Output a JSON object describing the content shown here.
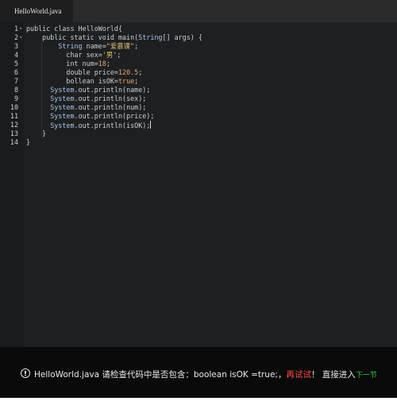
{
  "tab": {
    "label": "HelloWorld.java"
  },
  "editor": {
    "lines": [
      {
        "n": "1",
        "fold": "▾",
        "segments": [
          {
            "t": "public class HelloWorld{",
            "c": "pl"
          }
        ]
      },
      {
        "n": "2",
        "fold": "▾",
        "segments": [
          {
            "t": "    public static void main(",
            "c": "pl"
          },
          {
            "t": "String",
            "c": "cls"
          },
          {
            "t": "[] args) {",
            "c": "pl"
          }
        ]
      },
      {
        "n": "3",
        "fold": "",
        "segments": [
          {
            "t": "        ",
            "c": "pl"
          },
          {
            "t": "String",
            "c": "cls"
          },
          {
            "t": " name=",
            "c": "pl"
          },
          {
            "t": "\"爱慕课\"",
            "c": "str"
          },
          {
            "t": ";",
            "c": "pl"
          }
        ]
      },
      {
        "n": "4",
        "fold": "",
        "segments": [
          {
            "t": "          char sex=",
            "c": "pl"
          },
          {
            "t": "'男'",
            "c": "str"
          },
          {
            "t": ";",
            "c": "pl"
          }
        ]
      },
      {
        "n": "5",
        "fold": "",
        "segments": [
          {
            "t": "          int num=",
            "c": "pl"
          },
          {
            "t": "18",
            "c": "num"
          },
          {
            "t": ";",
            "c": "pl"
          }
        ]
      },
      {
        "n": "6",
        "fold": "",
        "segments": [
          {
            "t": "          double price=",
            "c": "pl"
          },
          {
            "t": "120.5",
            "c": "num"
          },
          {
            "t": ";",
            "c": "pl"
          }
        ]
      },
      {
        "n": "7",
        "fold": "",
        "segments": [
          {
            "t": "          bollean isOK=",
            "c": "pl"
          },
          {
            "t": "true",
            "c": "num"
          },
          {
            "t": ";",
            "c": "pl"
          }
        ]
      },
      {
        "n": "8",
        "fold": "",
        "segments": [
          {
            "t": "      ",
            "c": "pl"
          },
          {
            "t": "System",
            "c": "cls"
          },
          {
            "t": ".out.println(name);",
            "c": "pl"
          }
        ]
      },
      {
        "n": "9",
        "fold": "",
        "segments": [
          {
            "t": "      ",
            "c": "pl"
          },
          {
            "t": "System",
            "c": "cls"
          },
          {
            "t": ".out.println(sex);",
            "c": "pl"
          }
        ]
      },
      {
        "n": "10",
        "fold": "",
        "segments": [
          {
            "t": "      ",
            "c": "pl"
          },
          {
            "t": "System",
            "c": "cls"
          },
          {
            "t": ".out.println(num);",
            "c": "pl"
          }
        ]
      },
      {
        "n": "11",
        "fold": "",
        "segments": [
          {
            "t": "      ",
            "c": "pl"
          },
          {
            "t": "System",
            "c": "cls"
          },
          {
            "t": ".out.println(price);",
            "c": "pl"
          }
        ]
      },
      {
        "n": "12",
        "fold": "",
        "segments": [
          {
            "t": "      ",
            "c": "pl"
          },
          {
            "t": "System",
            "c": "cls"
          },
          {
            "t": ".out.println(isOK);",
            "c": "pl"
          }
        ],
        "caret": true
      },
      {
        "n": "13",
        "fold": "",
        "segments": [
          {
            "t": "    }",
            "c": "pl"
          }
        ]
      },
      {
        "n": "14",
        "fold": "",
        "segments": [
          {
            "t": "}",
            "c": "pl"
          }
        ]
      }
    ]
  },
  "message": {
    "icon": "info-icon",
    "text": "HelloWorld.java 请检查代码中是否包含：boolean isOK =true;，",
    "retry": "再试试",
    "after_retry": "！ 直接进入",
    "next": "下一节"
  },
  "colors": {
    "editor_bg": "#1e1f21",
    "gutter_bg": "#1a1b1d",
    "tabbar_bg": "#2b2b2b",
    "message_bg": "#0a0a0a",
    "retry": "#ff4d4d",
    "next": "#35c84a",
    "class_name": "#a7c5ea",
    "string": "#e6c27a",
    "number": "#e6a46a"
  }
}
